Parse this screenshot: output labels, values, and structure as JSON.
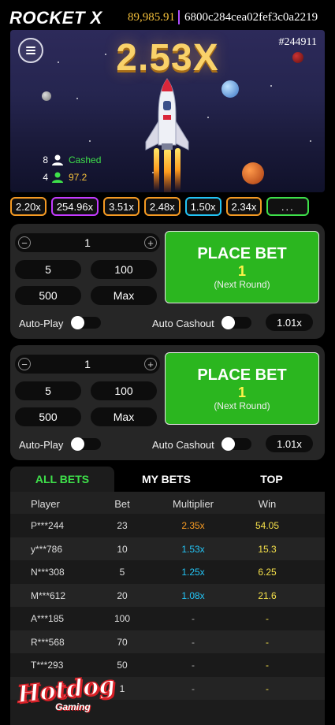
{
  "header": {
    "game_title": "ROCKET X",
    "balance": "89,985.91",
    "user_id": "6800c284cea02fef3c0a2219"
  },
  "game": {
    "round_id": "#244911",
    "multiplier": "2.53X",
    "players_cashed_count": "8",
    "players_cashed_label": "Cashed",
    "players_active_count": "4",
    "players_active_value": "97.2"
  },
  "history": [
    {
      "value": "2.20x",
      "color": "#f59a23"
    },
    {
      "value": "254.96x",
      "color": "#c43bff"
    },
    {
      "value": "3.51x",
      "color": "#f59a23"
    },
    {
      "value": "2.48x",
      "color": "#f59a23"
    },
    {
      "value": "1.50x",
      "color": "#23c4f5"
    },
    {
      "value": "2.34x",
      "color": "#f59a23"
    }
  ],
  "history_more": "...",
  "panels": [
    {
      "amount": "1",
      "quick": [
        "5",
        "100",
        "500",
        "Max"
      ],
      "place_bet": "PLACE BET",
      "bet_amount": "1",
      "note": "(Next Round)",
      "autoplay": "Auto-Play",
      "autocashout": "Auto Cashout",
      "cashout_value": "1.01x"
    },
    {
      "amount": "1",
      "quick": [
        "5",
        "100",
        "500",
        "Max"
      ],
      "place_bet": "PLACE BET",
      "bet_amount": "1",
      "note": "(Next Round)",
      "autoplay": "Auto-Play",
      "autocashout": "Auto Cashout",
      "cashout_value": "1.01x"
    }
  ],
  "bets": {
    "tabs": [
      "ALL BETS",
      "MY BETS",
      "TOP"
    ],
    "headers": [
      "Player",
      "Bet",
      "Multiplier",
      "Win"
    ],
    "rows": [
      {
        "player": "P***244",
        "bet": "23",
        "multiplier": "2.35x",
        "mcolor": "#f59a23",
        "win": "54.05",
        "wcolor": "#f5e04a"
      },
      {
        "player": "y***786",
        "bet": "10",
        "multiplier": "1.53x",
        "mcolor": "#23c4f5",
        "win": "15.3",
        "wcolor": "#f5e04a"
      },
      {
        "player": "N***308",
        "bet": "5",
        "multiplier": "1.25x",
        "mcolor": "#23c4f5",
        "win": "6.25",
        "wcolor": "#f5e04a"
      },
      {
        "player": "M***612",
        "bet": "20",
        "multiplier": "1.08x",
        "mcolor": "#23c4f5",
        "win": "21.6",
        "wcolor": "#f5e04a"
      },
      {
        "player": "A***185",
        "bet": "100",
        "multiplier": "-",
        "mcolor": "#aaaaaa",
        "win": "-",
        "wcolor": "#f5e04a"
      },
      {
        "player": "R***568",
        "bet": "70",
        "multiplier": "-",
        "mcolor": "#aaaaaa",
        "win": "-",
        "wcolor": "#f5e04a"
      },
      {
        "player": "T***293",
        "bet": "50",
        "multiplier": "-",
        "mcolor": "#aaaaaa",
        "win": "-",
        "wcolor": "#f5e04a"
      },
      {
        "player": "",
        "bet": "1",
        "multiplier": "-",
        "mcolor": "#aaaaaa",
        "win": "-",
        "wcolor": "#f5e04a"
      }
    ]
  },
  "brand": {
    "name": "Hotdog",
    "sub": "Gaming"
  }
}
